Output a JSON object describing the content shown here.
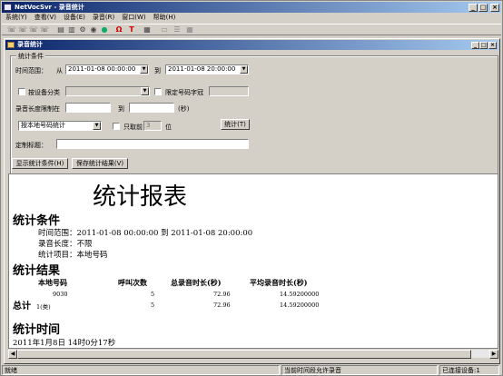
{
  "window": {
    "title": "NetVocSvr - 录音统计"
  },
  "menu": [
    "系统(Y)",
    "查看(V)",
    "设备(E)",
    "录音(R)",
    "窗口(W)",
    "帮助(H)"
  ],
  "toolbar_icons": [
    "phone-icon",
    "phone-icon",
    "phone-icon",
    "phone-icon",
    "device-icon",
    "device-icon",
    "settings-icon",
    "record-icon",
    "globe-icon",
    "omega-icon",
    "text-icon",
    "chart-icon",
    "window-icon",
    "list-icon",
    "grid-icon"
  ],
  "child": {
    "title": "录音统计"
  },
  "form": {
    "group_label": "统计条件",
    "time_range_label": "时间范围：",
    "from_label": "从",
    "from_value": "2011-01-08 00:00:00",
    "to_label": "到",
    "to_value": "2011-01-08 20:00:00",
    "by_device_label": "按设备分类",
    "prefix_label": "限定号码字冠",
    "duration_label": "录音长度限制在",
    "duration_to": "到",
    "duration_unit": "(秒)",
    "stat_type": "按本地号码统计",
    "only_top_label": "只取前",
    "only_top_value": "3",
    "only_top_unit": "位",
    "stat_button": "统计(T)",
    "custom_title_label": "定制标题："
  },
  "buttons": {
    "show_conditions": "显示统计条件(H)",
    "save_results": "保存统计结果(V)"
  },
  "report": {
    "title": "统计报表",
    "cond_heading": "统计条件",
    "cond_time": "时间范围：2011-01-08 00:00:00 到 2011-01-08 20:00:00",
    "cond_duration": "录音长度：不限",
    "cond_item": "统计项目：本地号码",
    "result_heading": "统计结果",
    "columns": [
      "本地号码",
      "呼叫次数",
      "总录音时长(秒)",
      "平均录音时长(秒)"
    ],
    "rows": [
      {
        "number": "9030",
        "calls": "5",
        "total": "72.96",
        "avg": "14.59200000"
      }
    ],
    "total_label": "总计",
    "total_count": "1(类)",
    "total_calls": "5",
    "total_total": "72.96",
    "total_avg": "14.59200000",
    "time_heading": "统计时间",
    "stat_time": "2011年1月8日 14时0分17秒"
  },
  "status": {
    "ready": "就绪",
    "record_state": "当前时间段允许录音",
    "connected": "已连接设备:1"
  }
}
